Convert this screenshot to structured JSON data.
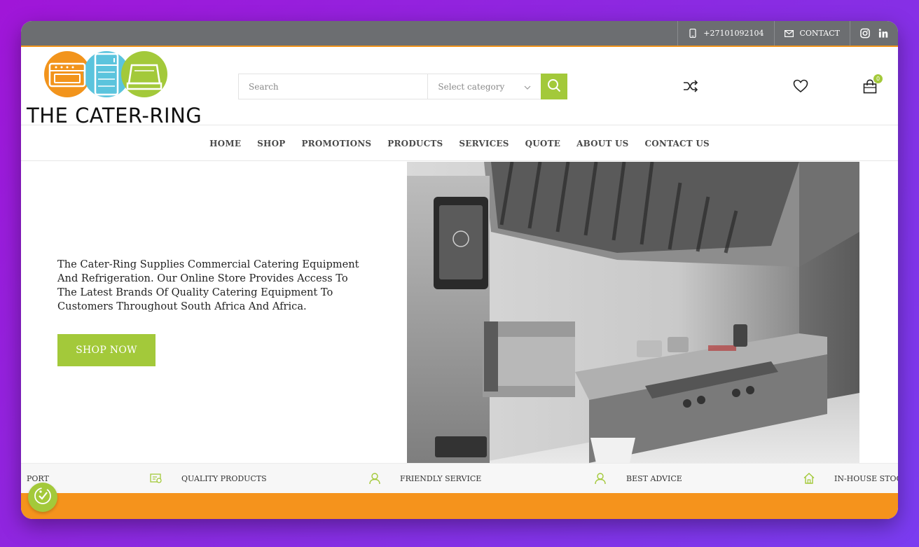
{
  "topbar": {
    "phone": "+27101092104",
    "contact_label": "CONTACT"
  },
  "brand": {
    "name": "THE CATER-RING",
    "colors": {
      "orange": "#f2941c",
      "blue": "#5bc4dd",
      "green": "#a3c93a"
    }
  },
  "search": {
    "placeholder": "Search",
    "category_label": "Select category"
  },
  "cart": {
    "count": "0"
  },
  "nav": {
    "items": [
      "HOME",
      "SHOP",
      "PROMOTIONS",
      "PRODUCTS",
      "SERVICES",
      "QUOTE",
      "ABOUT US",
      "CONTACT US"
    ]
  },
  "hero": {
    "text": "The Cater-Ring Supplies Commercial Catering Equipment And Refrigeration. Our Online Store Provides Access To The Latest Brands Of Quality Catering Equipment To Customers Throughout South Africa And Africa.",
    "button_label": "SHOP NOW"
  },
  "features": {
    "items": [
      "PORT",
      "QUALITY PRODUCTS",
      "FRIENDLY SERVICE",
      "BEST ADVICE",
      "IN-HOUSE STOCK"
    ]
  },
  "icons": {
    "phone": "phone-icon",
    "contact": "envelope-icon",
    "instagram": "instagram-icon",
    "linkedin": "linkedin-icon",
    "search": "search-icon",
    "shuffle": "shuffle-icon",
    "wishlist": "heart-icon",
    "cart": "cart-icon"
  }
}
